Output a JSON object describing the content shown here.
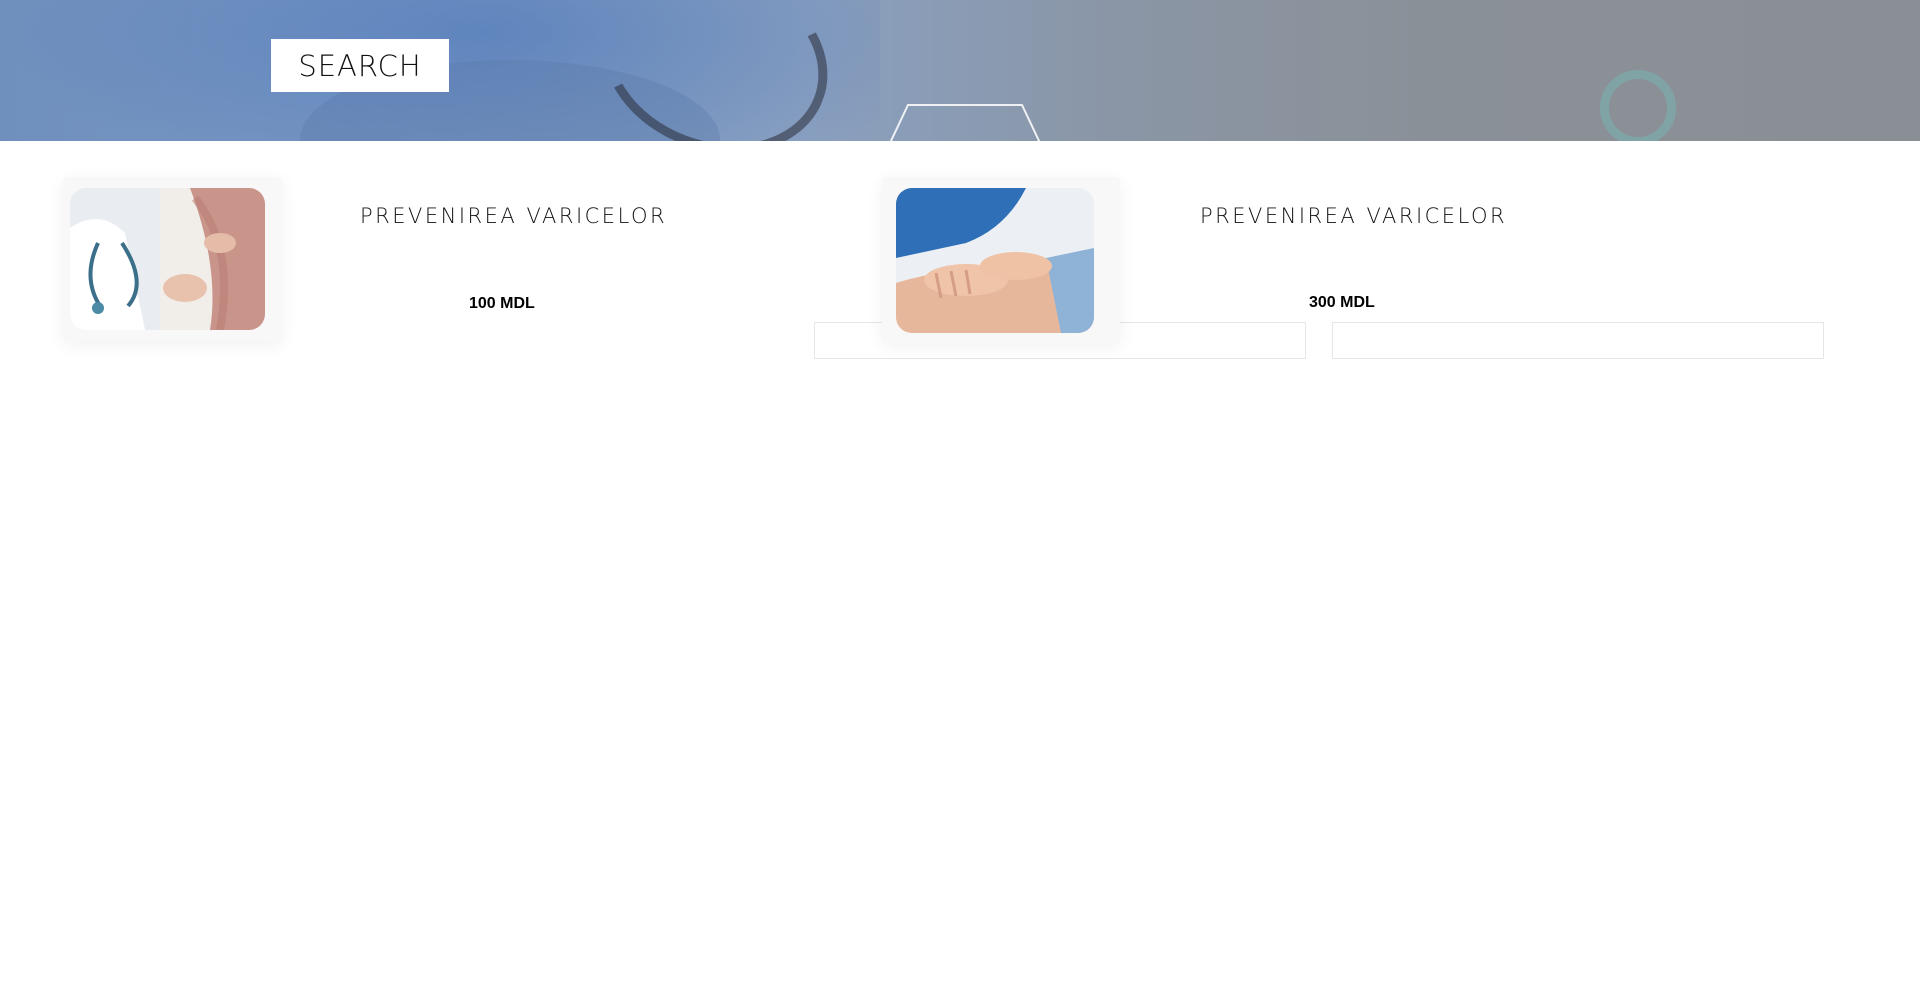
{
  "header": {
    "search_label": "SEARCH"
  },
  "products": [
    {
      "title": "PREVENIREA VARICELOR",
      "price": "100 MDL",
      "image_icon": "doctor-examining-leg-image"
    },
    {
      "title": "PREVENIREA VARICELOR",
      "price": "300 MDL",
      "image_icon": "leg-massage-image"
    }
  ],
  "colors": {
    "hero_blue": "#7c9ac4",
    "hero_gray": "#8a8f95",
    "ring_teal": "#78b4b4",
    "border": "#e6e6e6"
  }
}
